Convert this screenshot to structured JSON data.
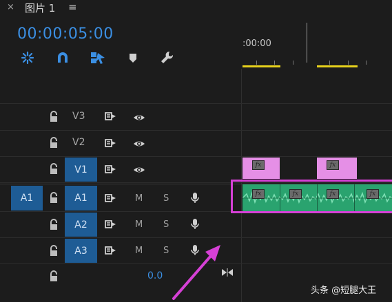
{
  "header": {
    "close_glyph": "×",
    "tab_title": "图片 1",
    "menu_glyph": "≡",
    "timecode": "00:00:05:00"
  },
  "toolbar": {
    "tools": [
      "snap-insert-icon",
      "magnet-icon",
      "linked-selection-icon",
      "marker-icon",
      "wrench-icon"
    ]
  },
  "ruler": {
    "label": ":00:00"
  },
  "tracks": {
    "video": [
      {
        "label": "V3",
        "icons": [
          "lock-icon",
          "sync-lock-icon",
          "eye-icon"
        ]
      },
      {
        "label": "V2",
        "icons": [
          "lock-icon",
          "sync-lock-icon",
          "eye-icon"
        ]
      },
      {
        "label": "V1",
        "icons": [
          "lock-icon",
          "sync-lock-icon",
          "eye-icon"
        ]
      }
    ],
    "audio": [
      {
        "source": "A1",
        "label": "A1",
        "mute": "M",
        "solo": "S"
      },
      {
        "label": "A2",
        "mute": "M",
        "solo": "S"
      },
      {
        "label": "A3",
        "mute": "M",
        "solo": "S"
      }
    ],
    "master_volume": "0.0"
  },
  "clips": {
    "fx_label": "fx"
  },
  "colors": {
    "accent_blue": "#3b8fe3",
    "track_target": "#1e5c95",
    "video_clip": "#e58fe6",
    "audio_clip": "#2aa36f",
    "highlight": "#d640d6",
    "work_area": "#e8d21c"
  },
  "watermark": "头条 @短腿大王"
}
